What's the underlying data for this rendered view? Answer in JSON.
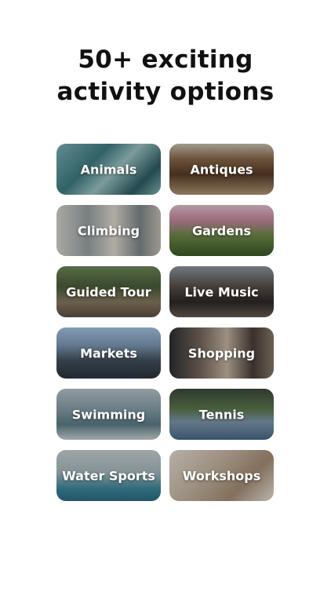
{
  "headline": {
    "line1": "50+ exciting",
    "line2": "activity options"
  },
  "activities": [
    {
      "label": "Animals"
    },
    {
      "label": "Antiques"
    },
    {
      "label": "Climbing"
    },
    {
      "label": "Gardens"
    },
    {
      "label": "Guided Tour"
    },
    {
      "label": "Live Music"
    },
    {
      "label": "Markets"
    },
    {
      "label": "Shopping"
    },
    {
      "label": "Swimming"
    },
    {
      "label": "Tennis"
    },
    {
      "label": "Water Sports"
    },
    {
      "label": "Workshops"
    }
  ]
}
